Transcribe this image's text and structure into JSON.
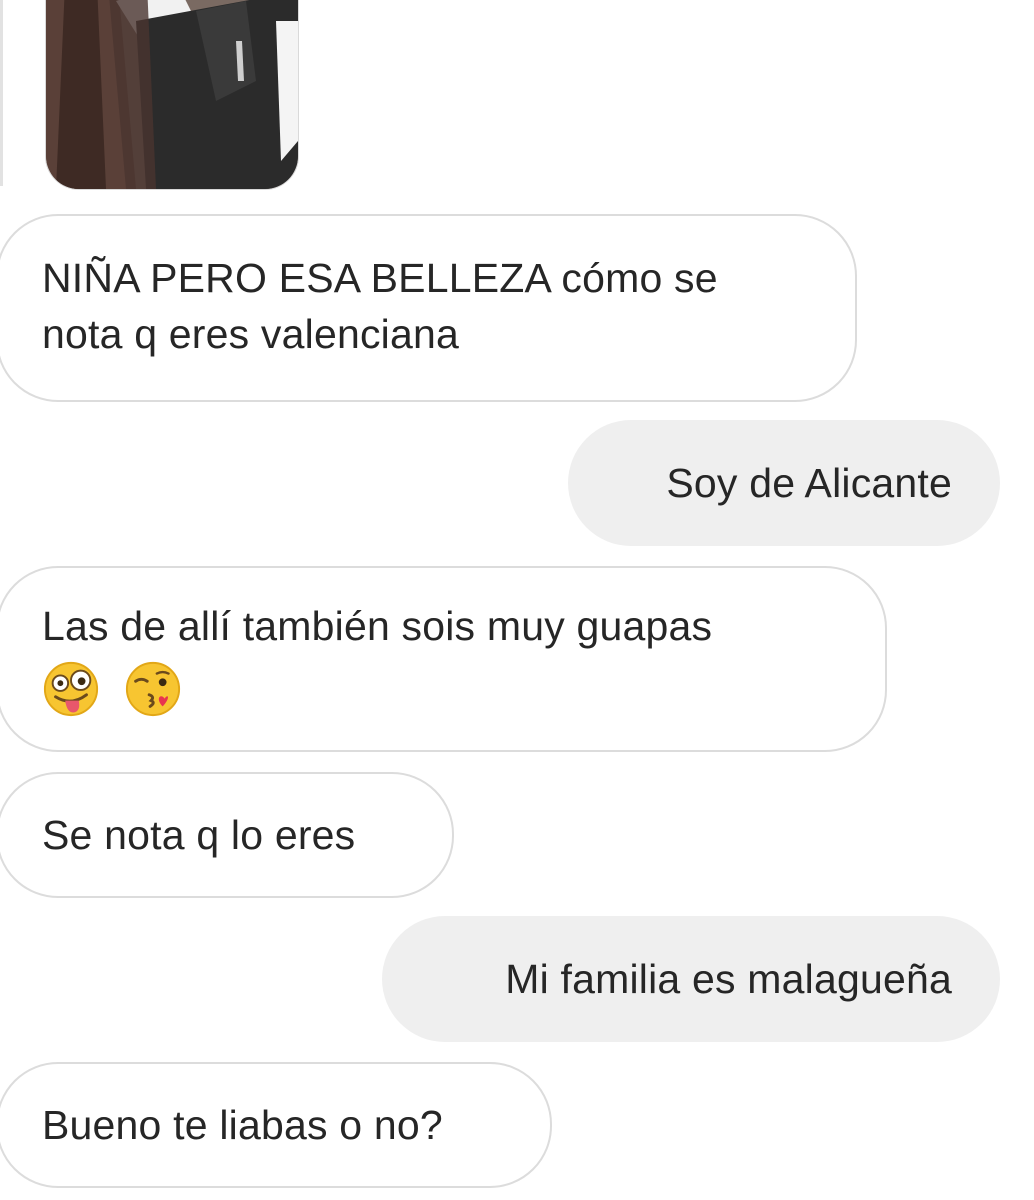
{
  "thread": {
    "messages": [
      {
        "side": "incoming",
        "lines": [
          "NIÑA PERO ESA BELLEZA cómo se",
          "nota q eres valenciana"
        ]
      },
      {
        "side": "outgoing",
        "lines": [
          "Soy de Alicante"
        ]
      },
      {
        "side": "incoming",
        "lines": [
          "Las de allí también sois muy guapas"
        ],
        "emojis": [
          "zany-face-emoji",
          "face-blowing-kiss-emoji"
        ]
      },
      {
        "side": "incoming",
        "lines": [
          "Se nota q lo eres"
        ]
      },
      {
        "side": "outgoing",
        "lines": [
          "Mi familia es malagueña"
        ]
      },
      {
        "side": "incoming",
        "lines": [
          "Bueno te liabas o no?"
        ]
      }
    ]
  },
  "colors": {
    "incoming_bg": "#ffffff",
    "incoming_border": "#dcdcdc",
    "outgoing_bg": "#efefef",
    "text": "#262626"
  }
}
